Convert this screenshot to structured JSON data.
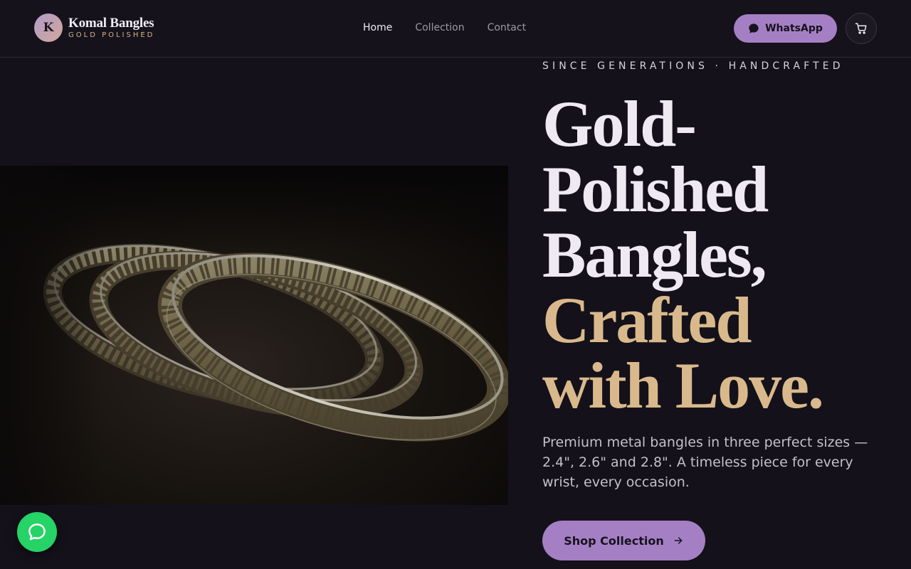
{
  "brand": {
    "initial": "K",
    "name": "Komal Bangles",
    "tagline": "GOLD POLISHED"
  },
  "nav": {
    "items": [
      {
        "label": "Home",
        "active": true
      },
      {
        "label": "Collection",
        "active": false
      },
      {
        "label": "Contact",
        "active": false
      }
    ]
  },
  "header_actions": {
    "whatsapp_label": "WhatsApp",
    "whatsapp_icon": "chat-bubble-icon",
    "cart_icon": "cart-icon"
  },
  "hero": {
    "eyebrow": "SINCE GENERATIONS · HANDCRAFTED",
    "headline_line1": "Gold-",
    "headline_line2": "Polished",
    "headline_line3": "Bangles,",
    "headline_line4": "Crafted",
    "headline_line5": "with Love.",
    "description": "Premium metal bangles in three perfect sizes — 2.4\", 2.6\" and 2.8\". A timeless piece for every wrist, every occasion.",
    "cta_label": "Shop Collection",
    "cta_icon": "arrow-right-icon"
  },
  "floating_chat": {
    "icon": "chat-bubble-icon"
  },
  "colors": {
    "background": "#14111a",
    "accent_purple": "#a57fc4",
    "accent_gold": "#d9b98c",
    "whatsapp_green": "#25d366"
  }
}
